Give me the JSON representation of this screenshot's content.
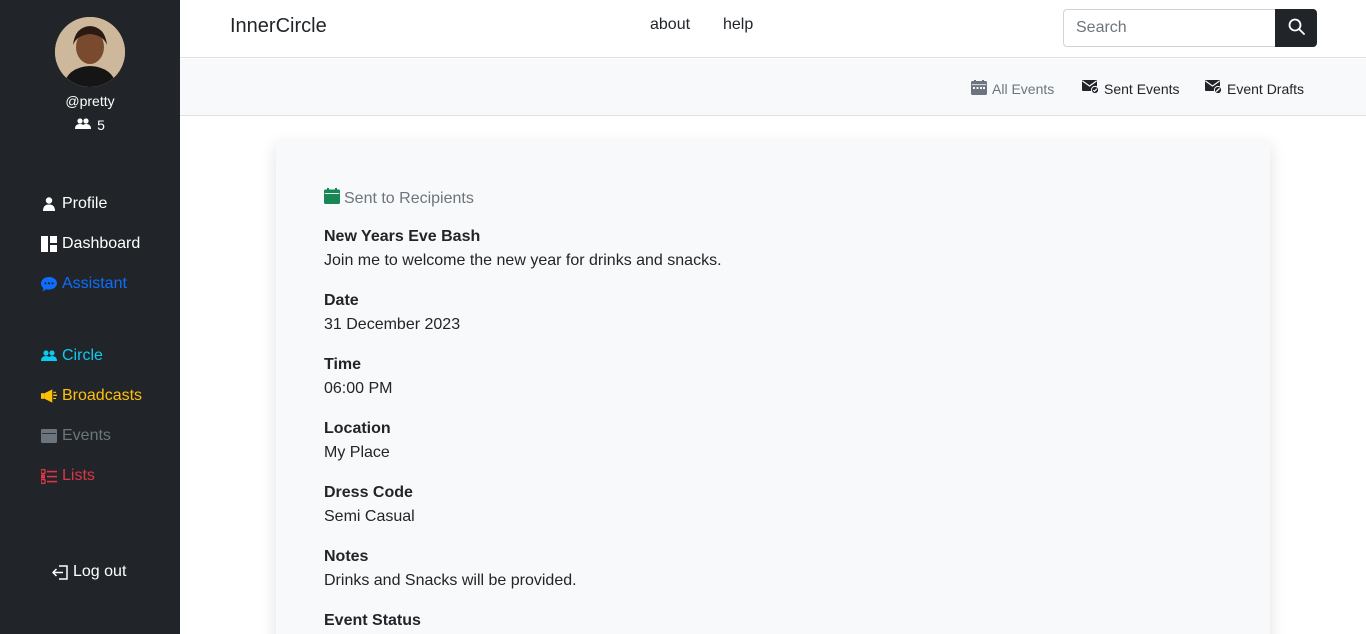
{
  "user": {
    "handle": "@pretty",
    "circle_count": "5"
  },
  "sidebar": {
    "primary": [
      {
        "label": "Profile",
        "icon": "user-icon",
        "color": "#ffffff"
      },
      {
        "label": "Dashboard",
        "icon": "dashboard-icon",
        "color": "#ffffff"
      },
      {
        "label": "Assistant",
        "icon": "chat-icon",
        "color": "#0d6efd"
      }
    ],
    "secondary": [
      {
        "label": "Circle",
        "icon": "users-icon",
        "color": "#0dcaf0"
      },
      {
        "label": "Broadcasts",
        "icon": "megaphone-icon",
        "color": "#ffc107"
      },
      {
        "label": "Events",
        "icon": "wallet-icon",
        "color": "#6c757d"
      },
      {
        "label": "Lists",
        "icon": "list-icon",
        "color": "#dc3545"
      }
    ],
    "logout": {
      "label": "Log out",
      "icon": "logout-icon"
    }
  },
  "header": {
    "brand": "InnerCircle",
    "links": [
      "about",
      "help"
    ],
    "search_placeholder": "Search"
  },
  "subnav": {
    "tabs": [
      {
        "label": "All Events",
        "icon": "calendar-week-icon",
        "active": true
      },
      {
        "label": "Sent Events",
        "icon": "envelope-check-icon",
        "active": false
      },
      {
        "label": "Event Drafts",
        "icon": "envelope-draft-icon",
        "active": false
      }
    ]
  },
  "event": {
    "status": "Sent to Recipients",
    "title": "New Years Eve Bash",
    "description": "Join me to welcome the new year for drinks and snacks.",
    "fields": [
      {
        "label": "Date",
        "value": "31 December 2023"
      },
      {
        "label": "Time",
        "value": "06:00 PM"
      },
      {
        "label": "Location",
        "value": "My Place"
      },
      {
        "label": "Dress Code",
        "value": "Semi Casual"
      },
      {
        "label": "Notes",
        "value": "Drinks and Snacks will be provided."
      },
      {
        "label": "Event Status",
        "value": ""
      }
    ]
  },
  "colors": {
    "sidebar_bg": "#212529",
    "status_green": "#198754",
    "subbar_bg": "#f8f9fa"
  }
}
